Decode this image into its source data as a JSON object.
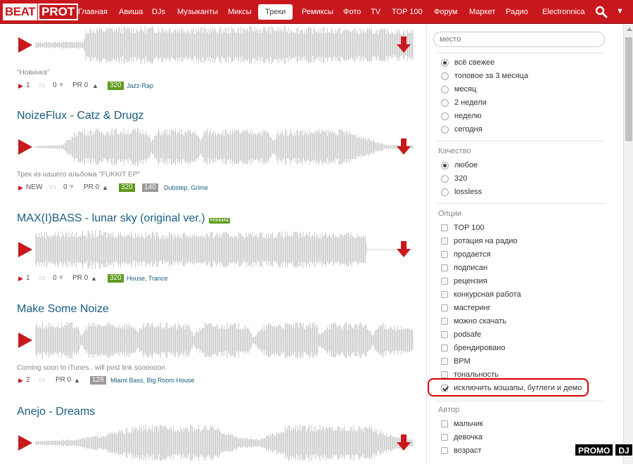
{
  "nav": {
    "logo_left": "BEAT",
    "logo_right": "PROT",
    "items": [
      "Главная",
      "Авиша",
      "DJs",
      "Музыканты",
      "Миксы",
      "Треки",
      "Ремиксы",
      "Фото",
      "TV",
      "TOP 100",
      "Форум",
      "Маркет",
      "Радио",
      "Electronnica"
    ],
    "active": "Треки",
    "menu_glyph": "▼"
  },
  "tracks": [
    {
      "title": "",
      "desc": "\"Новинка\"",
      "plays": "1",
      "comments": "0",
      "pr": "PR 0",
      "quality": "320",
      "bpm": "",
      "genre": "Jazz-Rap",
      "badge": ""
    },
    {
      "title": "NoizeFlux - Catz & Drugz",
      "desc": "Трек из нашего альбома \"FUKKIT EP\"",
      "plays": "NEW",
      "comments": "0",
      "pr": "PR 0",
      "quality": "320",
      "bpm": "140",
      "genre": "Dubstep, Grime",
      "badge": ""
    },
    {
      "title": "MAX(I)BASS - lunar sky (original ver.)",
      "desc": "",
      "plays": "1",
      "comments": "0",
      "pr": "PR 0",
      "quality": "320",
      "bpm": "",
      "genre": "House, Trance",
      "badge": "PODSAFE"
    },
    {
      "title": "Make Some Noize",
      "desc": "Coming soon to iTunes.. will post link soooooon",
      "plays": "2",
      "comments": "",
      "pr": "PR 0",
      "quality": "",
      "bpm": "128",
      "genre": "Miami Bass, Big Room House",
      "badge": ""
    },
    {
      "title": "Anejo - Dreams",
      "desc": "",
      "plays": "",
      "comments": "",
      "pr": "",
      "quality": "",
      "bpm": "",
      "genre": "",
      "badge": ""
    }
  ],
  "filters": {
    "place_placeholder": "место",
    "period": [
      {
        "label": "всё свежее",
        "checked": true
      },
      {
        "label": "топовое за 3 месяца",
        "checked": false
      },
      {
        "label": "месяц",
        "checked": false
      },
      {
        "label": "2 недели",
        "checked": false
      },
      {
        "label": "неделю",
        "checked": false
      },
      {
        "label": "сегодня",
        "checked": false
      }
    ],
    "quality_title": "Качество",
    "quality": [
      {
        "label": "любое",
        "checked": true
      },
      {
        "label": "320",
        "checked": false
      },
      {
        "label": "lossless",
        "checked": false
      }
    ],
    "options_title": "Опции",
    "options": [
      {
        "label": "TOP 100",
        "checked": false
      },
      {
        "label": "ротация на радио",
        "checked": false
      },
      {
        "label": "продается",
        "checked": false
      },
      {
        "label": "подписан",
        "checked": false
      },
      {
        "label": "рецензия",
        "checked": false
      },
      {
        "label": "конкурсная работа",
        "checked": false
      },
      {
        "label": "мастеринг",
        "checked": false
      },
      {
        "label": "можно скачать",
        "checked": false
      },
      {
        "label": "podsafe",
        "checked": false
      },
      {
        "label": "брендировано",
        "checked": false
      },
      {
        "label": "BPM",
        "checked": false
      },
      {
        "label": "тональность",
        "checked": false
      },
      {
        "label": "исключить мэшапы, бутлеги и демо",
        "checked": true
      }
    ],
    "author_title": "Автор",
    "author": [
      {
        "label": "мальчик",
        "checked": false
      },
      {
        "label": "девочка",
        "checked": false
      },
      {
        "label": "возраст",
        "checked": false
      }
    ]
  },
  "watermark": {
    "left": "PROMO",
    "right": "DJ"
  },
  "colors": {
    "brand": "#c8181d",
    "link": "#1a5d80",
    "quality_badge": "#5e9a1d",
    "highlight": "#d40000"
  }
}
